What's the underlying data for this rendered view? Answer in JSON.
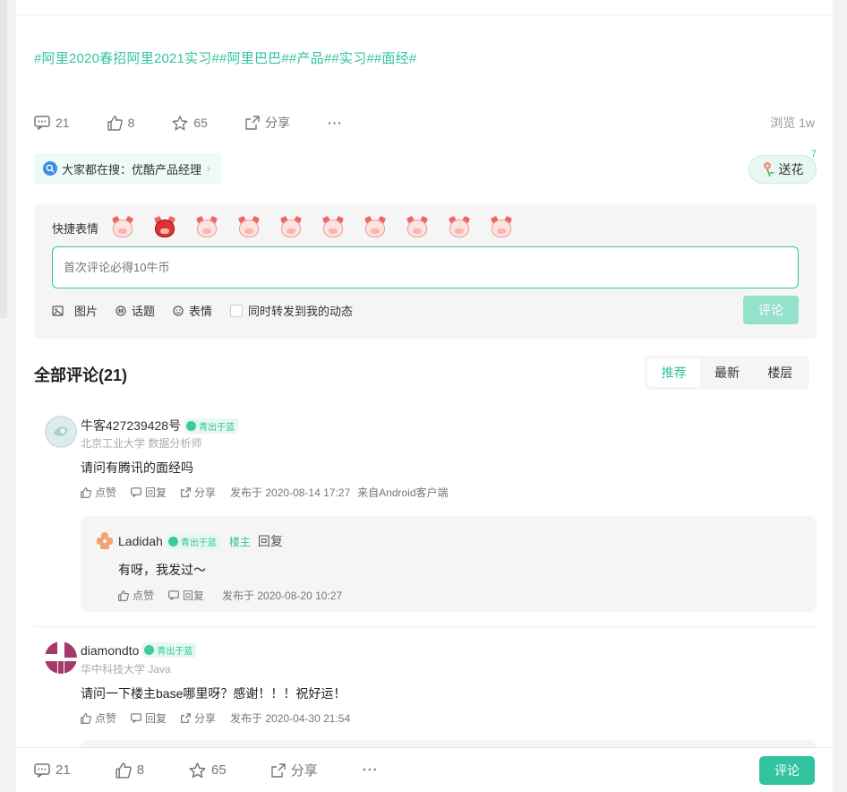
{
  "post": {
    "tags": "#阿里2020春招阿里2021实习##阿里巴巴##产品##实习##面经#",
    "comments_count": "21",
    "likes_count": "8",
    "favorites_count": "65",
    "share_label": "分享",
    "more_label": "···",
    "views": "浏览 1w"
  },
  "search_chip": {
    "label": "大家都在搜：优酷产品经理",
    "chevron": "›"
  },
  "flower": {
    "label": "送花",
    "count": "7"
  },
  "composer": {
    "emoji_label": "快捷表情",
    "placeholder": "首次评论必得10牛币",
    "tools": [
      "图片",
      "话题",
      "表情"
    ],
    "repost_label": "同时转发到我的动态",
    "submit_label": "评论"
  },
  "comments_header": {
    "title": "全部评论(21)",
    "sort_options": [
      "推荐",
      "最新",
      "楼层"
    ]
  },
  "comments": [
    {
      "username": "牛客427239428号",
      "badge": "青出于蓝",
      "meta": "北京工业大学 数据分析师",
      "body": "请问有腾讯的面经吗",
      "like": "点赞",
      "reply": "回复",
      "share": "分享",
      "time": "发布于 2020-08-14 17:27",
      "client": "来自Android客户端"
    },
    {
      "username": "diamondto",
      "badge": "青出于蓝",
      "meta": "华中科技大学 Java",
      "body": "请问一下楼主base哪里呀？感谢！！！祝好运！",
      "like": "点赞",
      "reply": "回复",
      "share": "分享",
      "time": "发布于 2020-04-30 21:54"
    }
  ],
  "reply": {
    "username": "Ladidah",
    "badge": "青出于蓝",
    "op_tag": "楼主",
    "reply_label": "回复",
    "body": "有呀，我发过～",
    "like": "点赞",
    "reply": "回复",
    "time": "发布于 2020-08-20 10:27"
  },
  "bottom_bar": {
    "comments_count": "21",
    "likes_count": "8",
    "favorites_count": "65",
    "share_label": "分享",
    "more_label": "···",
    "submit_label": "评论"
  },
  "colors": {
    "accent": "#32c3a0",
    "accent_disabled": "#94e1cc"
  },
  "icons": [
    "comment-icon",
    "like-icon",
    "star-icon",
    "share-icon",
    "more-icon",
    "search-icon",
    "flower-icon",
    "image-icon",
    "topic-icon",
    "emoji-icon"
  ]
}
